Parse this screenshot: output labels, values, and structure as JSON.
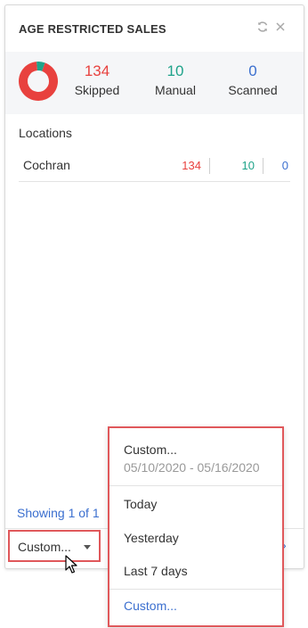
{
  "widget": {
    "title": "AGE RESTRICTED SALES",
    "refresh_icon": "refresh-icon",
    "close_icon": "close-icon"
  },
  "stats": {
    "skipped": {
      "value": "134",
      "label": "Skipped",
      "color": "#e8413e"
    },
    "manual": {
      "value": "10",
      "label": "Manual",
      "color": "#1fa38a"
    },
    "scanned": {
      "value": "0",
      "label": "Scanned",
      "color": "#3b6fcf"
    }
  },
  "chart_data": {
    "type": "pie",
    "donut": true,
    "categories": [
      "Skipped",
      "Manual",
      "Scanned"
    ],
    "values": [
      134,
      10,
      0
    ],
    "colors": [
      "#e8413e",
      "#1fa38a",
      "#3b6fcf"
    ]
  },
  "locations": {
    "heading": "Locations",
    "rows": [
      {
        "name": "Cochran",
        "skipped": "134",
        "manual": "10",
        "scanned": "0"
      }
    ]
  },
  "footer": {
    "showing": "Showing 1 of 1",
    "range_value": "Custom...",
    "next_icon": "chevron-right-icon"
  },
  "dropdown": {
    "custom_label": "Custom...",
    "custom_range": "05/10/2020 - 05/16/2020",
    "options": [
      "Today",
      "Yesterday",
      "Last 7 days"
    ],
    "custom_link": "Custom..."
  }
}
